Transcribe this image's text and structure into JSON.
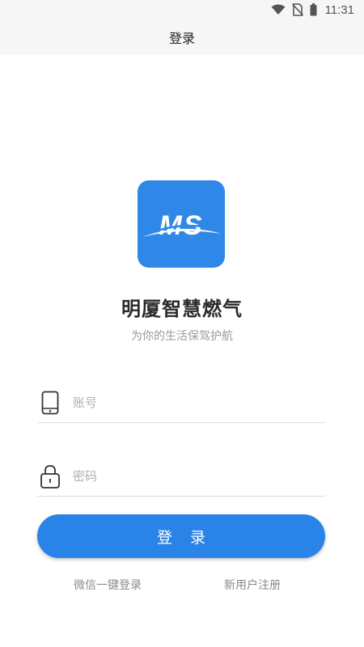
{
  "status_bar": {
    "time": "11:31",
    "icons": [
      "wifi-icon",
      "no-sim-icon",
      "battery-icon"
    ]
  },
  "header": {
    "title": "登录"
  },
  "brand": {
    "logo_text": "MS",
    "app_name": "明厦智慧燃气",
    "slogan": "为你的生活保驾护航",
    "logo_color": "#2f87e7"
  },
  "form": {
    "account_placeholder": "账号",
    "account_value": "",
    "account_icon": "phone-icon",
    "password_placeholder": "密码",
    "password_value": "",
    "password_icon": "lock-icon"
  },
  "actions": {
    "login_label": "登 录",
    "wechat_login_label": "微信一键登录",
    "register_label": "新用户注册",
    "accent_color": "#2a84e8"
  }
}
